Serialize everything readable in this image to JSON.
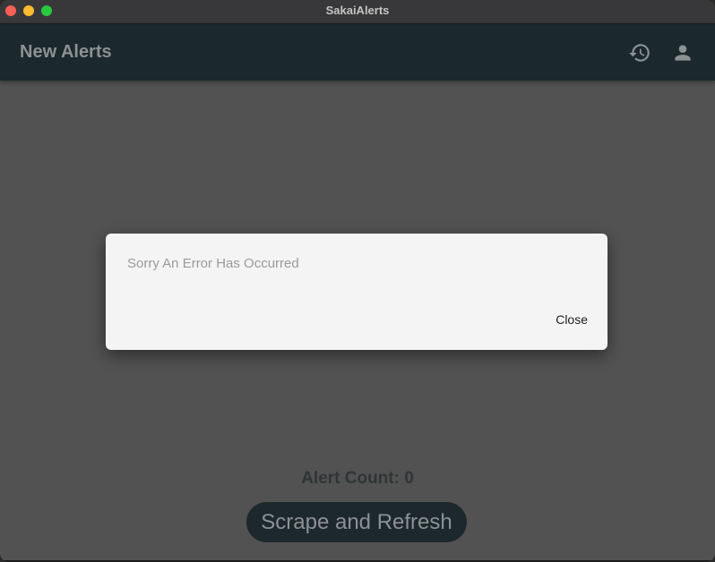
{
  "window": {
    "title": "SakaiAlerts",
    "traffic_lights": {
      "close_color": "#fe5f57",
      "minimize_color": "#febc2e",
      "maximize_color": "#28c840"
    }
  },
  "appbar": {
    "title": "New Alerts",
    "icons": {
      "history": "history-icon",
      "account": "account-icon"
    },
    "background": "#1b282c"
  },
  "main": {
    "alert_count_label": "Alert Count: 0",
    "scrape_button_label": "Scrape and Refresh"
  },
  "dialog": {
    "message": "Sorry An Error Has Occurred",
    "close_label": "Close"
  }
}
